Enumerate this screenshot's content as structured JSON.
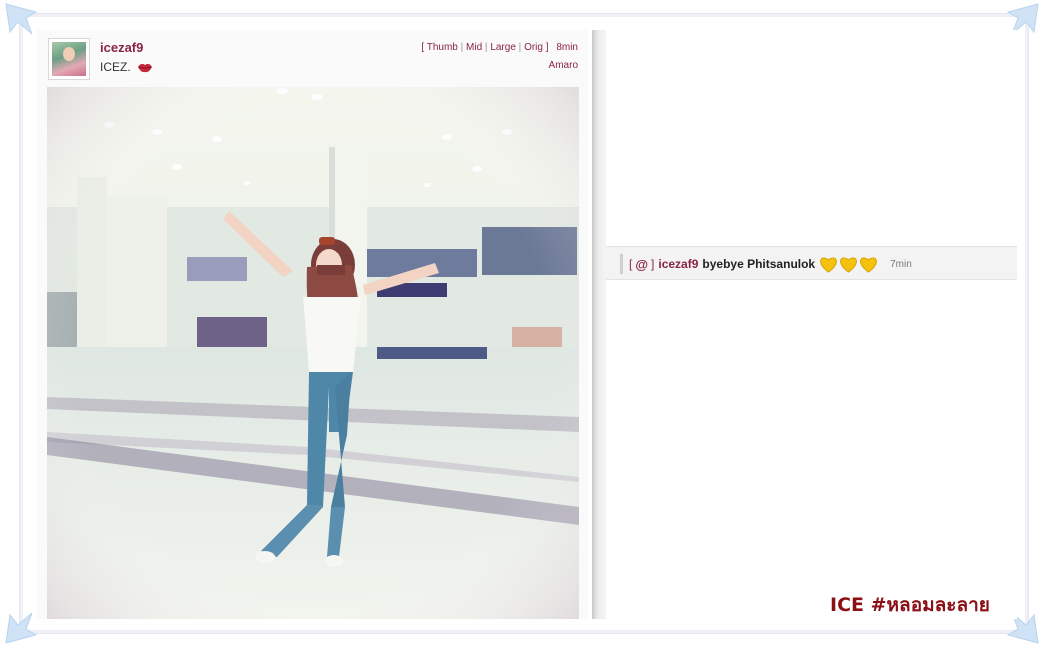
{
  "post": {
    "username": "icezaf9",
    "caption": "ICEZ.",
    "caption_emoji": "lips-icon",
    "size_links": {
      "open": "[",
      "thumb": "Thumb",
      "mid": "Mid",
      "large": "Large",
      "orig": "Orig",
      "close": "]",
      "sep": "|"
    },
    "age": "8min",
    "filter": "Amaro"
  },
  "comment": {
    "open_bracket": "[",
    "at_symbol": "@",
    "close_bracket": "]",
    "username": "icezaf9",
    "text": "byebye Phitsanulok",
    "emoji": [
      "yellow-heart-icon",
      "yellow-heart-icon",
      "yellow-heart-icon"
    ],
    "time": "7min"
  },
  "watermark": "ICE #หลอมละลาย",
  "colors": {
    "accent": "#8a2443",
    "heart": "#f4c20d",
    "watermark": "#8b1015"
  }
}
